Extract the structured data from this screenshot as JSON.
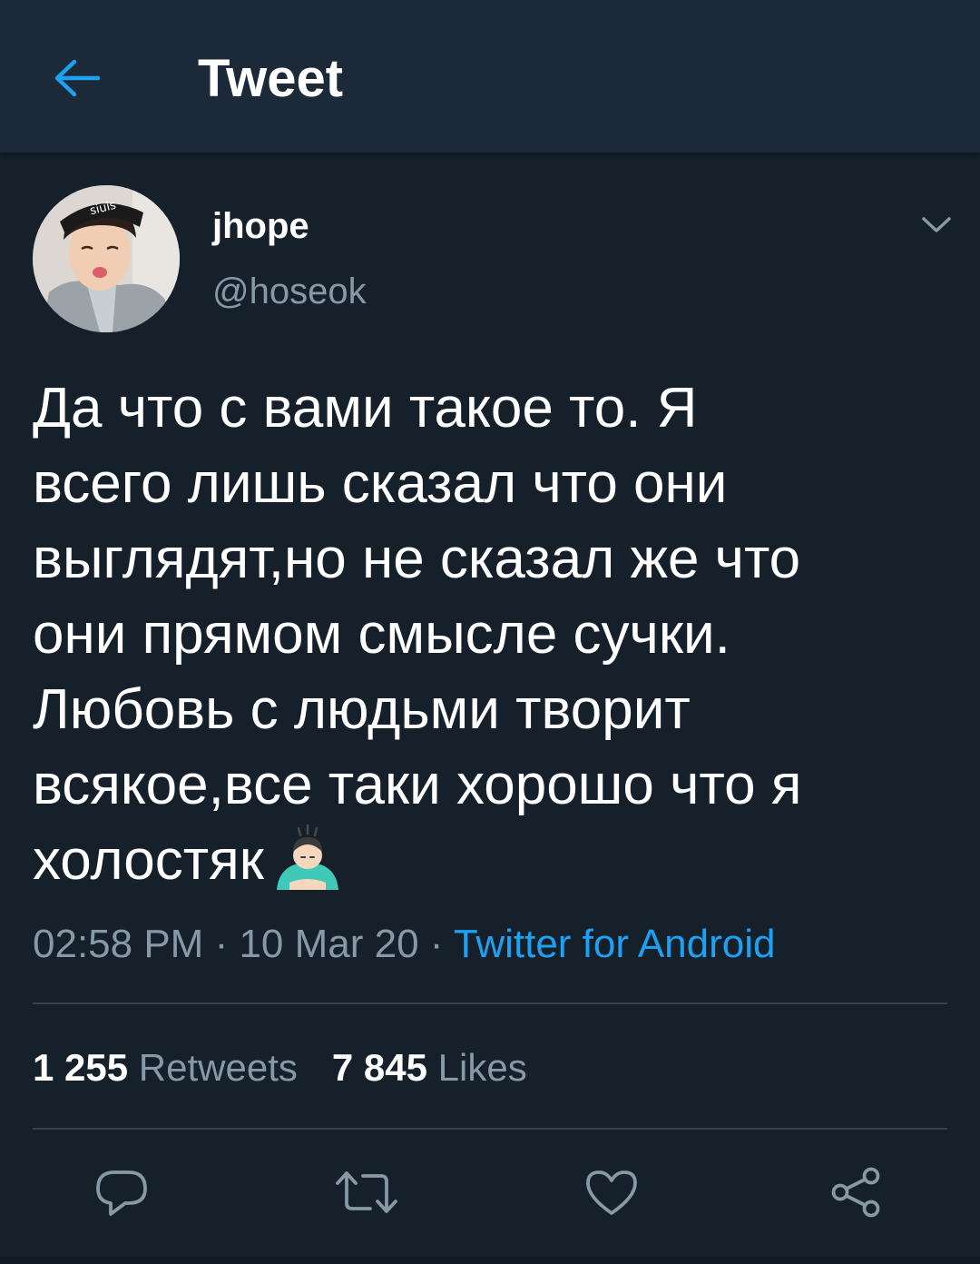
{
  "header": {
    "back_icon": "arrow-left-icon",
    "title": "Tweet"
  },
  "tweet": {
    "author_name": "jhope",
    "author_handle": "@hoseok",
    "avatar_cap_text": "siuis",
    "text": "Да что с вами такое то. Я\nвсего лишь сказал что они\nвыглядят,но не сказал же что\nони прямом смысле сучки.\nЛюбовь с людьми творит\nвсякое,все таки хорошо что я\nхолостяк",
    "emoji": "person-bowing-emoji",
    "time": "02:58 PM",
    "date": "10 Mar 20",
    "separator": " · ",
    "source": "Twitter for Android"
  },
  "stats": {
    "retweets_count": "1 255",
    "retweets_label": "Retweets",
    "likes_count": "7 845",
    "likes_label": "Likes"
  },
  "actions": [
    {
      "name": "reply",
      "icon": "reply-icon"
    },
    {
      "name": "retweet",
      "icon": "retweet-icon"
    },
    {
      "name": "like",
      "icon": "heart-icon"
    },
    {
      "name": "share",
      "icon": "share-icon"
    }
  ],
  "colors": {
    "background": "#15202b",
    "header_background": "#1c2938",
    "accent": "#1da1f2",
    "secondary_text": "#8899a6",
    "divider": "#38444d"
  }
}
